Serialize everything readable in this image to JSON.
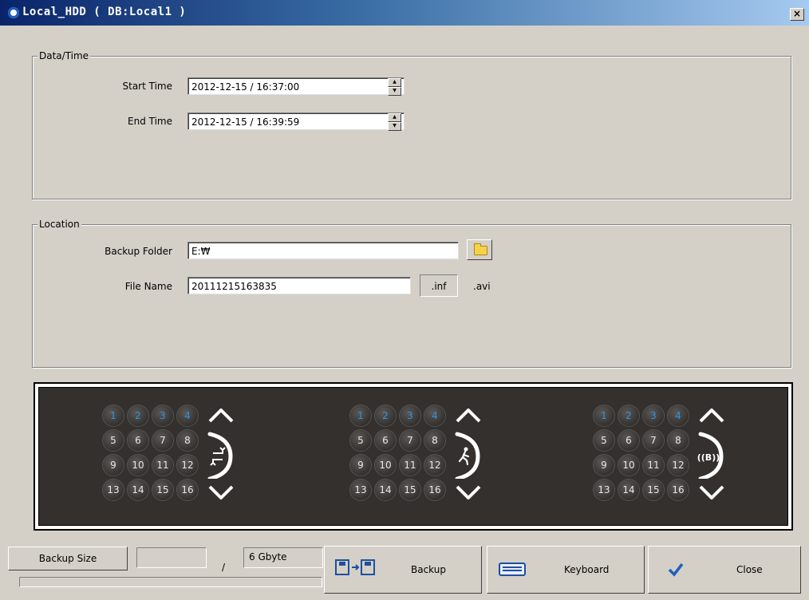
{
  "window": {
    "title": "Local_HDD ( DB:Local1 )",
    "close_glyph": "×"
  },
  "datetime": {
    "legend": "Data/Time",
    "start_label": "Start Time",
    "start_value": "2012-12-15 / 16:37:00",
    "end_label": "End Time",
    "end_value": "2012-12-15 / 16:39:59"
  },
  "location": {
    "legend": "Location",
    "folder_label": "Backup Folder",
    "folder_value": "E:₩",
    "file_label": "File Name",
    "file_value": "20111215163835",
    "ext_inf": ".inf",
    "ext_avi": ".avi"
  },
  "channel_panels": [
    {
      "mode_icon": "rotate-mode-icon",
      "channels": [
        "1",
        "2",
        "3",
        "4",
        "5",
        "6",
        "7",
        "8",
        "9",
        "10",
        "11",
        "12",
        "13",
        "14",
        "15",
        "16"
      ],
      "highlighted": [
        "1",
        "2",
        "3",
        "4"
      ]
    },
    {
      "mode_icon": "motion-mode-icon",
      "channels": [
        "1",
        "2",
        "3",
        "4",
        "5",
        "6",
        "7",
        "8",
        "9",
        "10",
        "11",
        "12",
        "13",
        "14",
        "15",
        "16"
      ],
      "highlighted": [
        "1",
        "2",
        "3",
        "4"
      ]
    },
    {
      "mode_icon": "alarm-mode-icon",
      "channels": [
        "1",
        "2",
        "3",
        "4",
        "5",
        "6",
        "7",
        "8",
        "9",
        "10",
        "11",
        "12",
        "13",
        "14",
        "15",
        "16"
      ],
      "highlighted": [
        "1",
        "2",
        "3",
        "4"
      ]
    }
  ],
  "bottom": {
    "backup_size_label": "Backup Size",
    "size_value": "",
    "separator": "/",
    "capacity": "6 Gbyte",
    "backup_label": "Backup",
    "keyboard_label": "Keyboard",
    "close_label": "Close"
  },
  "colors": {
    "titlebar_start": "#0a246a",
    "titlebar_end": "#a6caf0",
    "panel_bg": "#33302d",
    "channel_highlight": "#2d95e6",
    "check": "#1f5fbf"
  }
}
